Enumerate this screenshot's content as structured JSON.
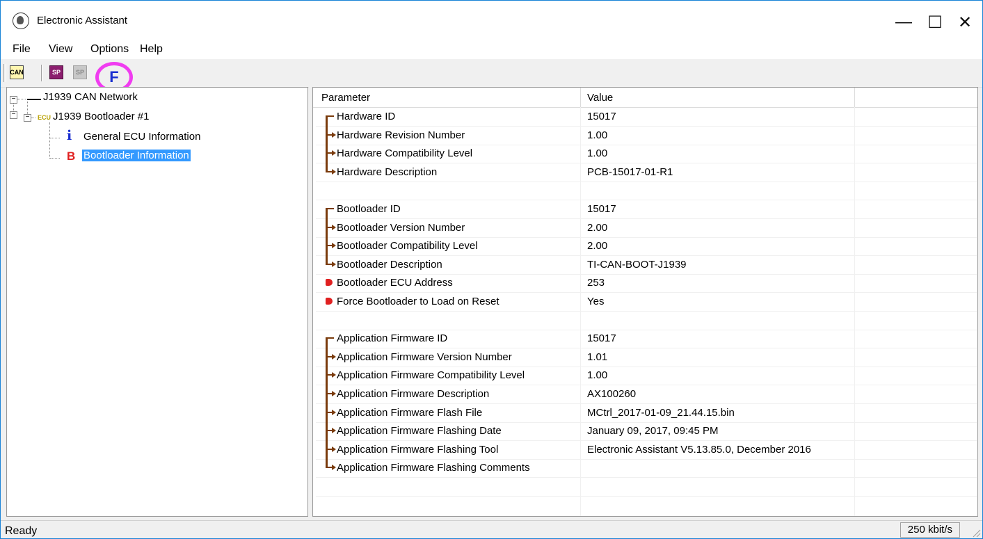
{
  "window": {
    "title": "Electronic Assistant"
  },
  "controls": {
    "minimize": "—",
    "maximize": "☐",
    "close": "✕"
  },
  "menu": [
    "File",
    "View",
    "Options",
    "Help"
  ],
  "toolbar": {
    "can_label": "CAN",
    "sp_label": "SP",
    "f_label": "F"
  },
  "tree": {
    "network": "J1939 CAN Network",
    "ecu_tag": "ECU",
    "bootloader": "J1939 Bootloader #1",
    "general": "General ECU Information",
    "info": "Bootloader Information",
    "i_glyph": "i",
    "b_glyph": "B"
  },
  "table": {
    "columns": [
      "Parameter",
      "Value"
    ],
    "rows": [
      {
        "param": "Hardware ID",
        "value": "15017",
        "marker": "first"
      },
      {
        "param": "Hardware Revision Number",
        "value": "1.00",
        "marker": "mid"
      },
      {
        "param": "Hardware Compatibility Level",
        "value": "1.00",
        "marker": "mid"
      },
      {
        "param": "Hardware Description",
        "value": "PCB-15017-01-R1",
        "marker": "last"
      },
      {
        "param": "",
        "value": "",
        "marker": "none"
      },
      {
        "param": "Bootloader ID",
        "value": "15017",
        "marker": "first"
      },
      {
        "param": "Bootloader Version Number",
        "value": "2.00",
        "marker": "mid"
      },
      {
        "param": "Bootloader Compatibility Level",
        "value": "2.00",
        "marker": "mid"
      },
      {
        "param": "Bootloader Description",
        "value": "TI-CAN-BOOT-J1939",
        "marker": "last"
      },
      {
        "param": "Bootloader ECU Address",
        "value": "253",
        "marker": "red"
      },
      {
        "param": "Force Bootloader to Load on Reset",
        "value": "Yes",
        "marker": "red"
      },
      {
        "param": "",
        "value": "",
        "marker": "none"
      },
      {
        "param": "Application Firmware ID",
        "value": "15017",
        "marker": "first"
      },
      {
        "param": "Application Firmware Version Number",
        "value": "1.01",
        "marker": "mid"
      },
      {
        "param": "Application Firmware Compatibility Level",
        "value": "1.00",
        "marker": "mid"
      },
      {
        "param": "Application Firmware Description",
        "value": "AX100260",
        "marker": "mid"
      },
      {
        "param": "Application Firmware Flash File",
        "value": "MCtrl_2017-01-09_21.44.15.bin",
        "marker": "mid"
      },
      {
        "param": "Application Firmware Flashing Date",
        "value": "January 09, 2017, 09:45 PM",
        "marker": "mid"
      },
      {
        "param": "Application Firmware Flashing Tool",
        "value": "Electronic Assistant V5.13.85.0, December 2016",
        "marker": "mid"
      },
      {
        "param": "Application Firmware Flashing Comments",
        "value": "",
        "marker": "last"
      },
      {
        "param": "",
        "value": "",
        "marker": "none"
      }
    ]
  },
  "status": {
    "left": "Ready",
    "rate": "250 kbit/s"
  },
  "colors": {
    "accent": "#3399ff",
    "marker": "#7a3b0c",
    "highlight": "#f03cf0",
    "red": "#e02020"
  }
}
